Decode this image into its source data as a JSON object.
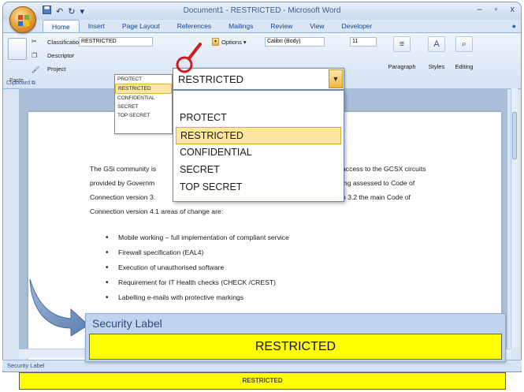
{
  "window": {
    "title": "Document1 - RESTRICTED - Microsoft Word",
    "controls": [
      "–",
      "▫",
      "x"
    ]
  },
  "tabs": [
    "Home",
    "Insert",
    "Page Layout",
    "References",
    "Mailings",
    "Review",
    "View",
    "Developer"
  ],
  "active_tab": "Home",
  "clipboard": {
    "paste_label": "Paste",
    "group_label": "Clipboard ⧉"
  },
  "classification": {
    "classification_label": "Classification",
    "classification_value": "RESTRICTED",
    "descriptor_label": "Descriptor",
    "project_label": "Project",
    "options_label": "Options ▾"
  },
  "font": {
    "font_name": "Calibri (Body)",
    "font_size": "11"
  },
  "ribbon_groups": {
    "paragraph": "Paragraph",
    "styles": "Styles",
    "editing": "Editing"
  },
  "small_dropdown": {
    "items": [
      "PROTECT",
      "RESTRICTED",
      "CONFIDENTIAL",
      "SECRET",
      "TOP SECRET"
    ],
    "selected": "RESTRICTED"
  },
  "big_dropdown": {
    "current": "RESTRICTED",
    "items": [
      "PROTECT",
      "RESTRICTED",
      "CONFIDENTIAL",
      "SECRET",
      "TOP SECRET"
    ],
    "selected": "RESTRICTED"
  },
  "document": {
    "para_line1_a": "The GSi community is",
    "para_line1_b": "access to the GCSX circuits",
    "para_line2_a": "provided by Governm",
    "para_line2_b": "ing assessed to Code of",
    "para_line3_a": "Connection version 3.",
    "para_line3_b": "n 3.2 the main Code of",
    "para_line4": "Connection version 4.1 areas of change are:",
    "bullets": [
      "Mobile working – full implementation of compliant service",
      "Firewall specification (EAL4)",
      "Execution of unauthorised software",
      "Requirement for IT Health checks (CHECK /CREST)",
      "Labelling e-mails with protective markings"
    ]
  },
  "security_banner": {
    "label": "Security Label",
    "value": "RESTRICTED"
  },
  "statusbar": {
    "text": "Security Label"
  },
  "bottom_bar": {
    "value": "RESTRICTED"
  },
  "colors": {
    "highlight_yellow": "#ffff00",
    "office_blue": "#dbe6f4"
  }
}
